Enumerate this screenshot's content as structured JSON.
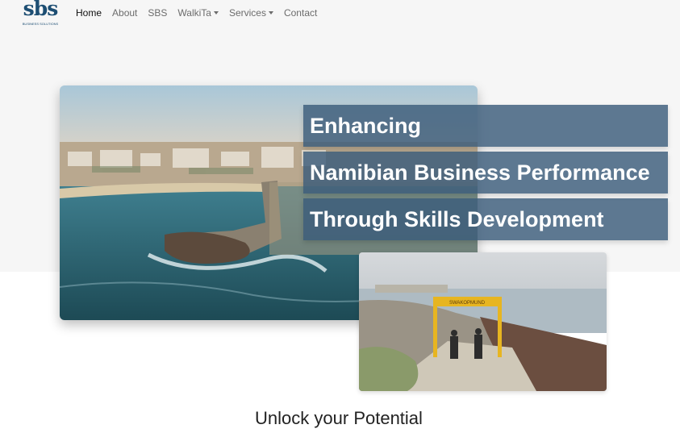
{
  "brand": {
    "logo_text": "sbs",
    "logo_subtext": "BUSINESS SOLUTIONS"
  },
  "nav": {
    "items": [
      {
        "label": "Home",
        "active": true,
        "dropdown": false
      },
      {
        "label": "About",
        "active": false,
        "dropdown": false
      },
      {
        "label": "SBS",
        "active": false,
        "dropdown": false
      },
      {
        "label": "WalkiTa",
        "active": false,
        "dropdown": true
      },
      {
        "label": "Services",
        "active": false,
        "dropdown": true
      },
      {
        "label": "Contact",
        "active": false,
        "dropdown": false
      }
    ]
  },
  "hero": {
    "headline_lines": [
      "Enhancing",
      "Namibian Business Performance",
      "Through Skills Development"
    ],
    "overlay_color": "#3a5c7a"
  },
  "section": {
    "title": "Unlock your Potential"
  },
  "second_photo": {
    "sign_text": "SWAKOPMUND"
  }
}
